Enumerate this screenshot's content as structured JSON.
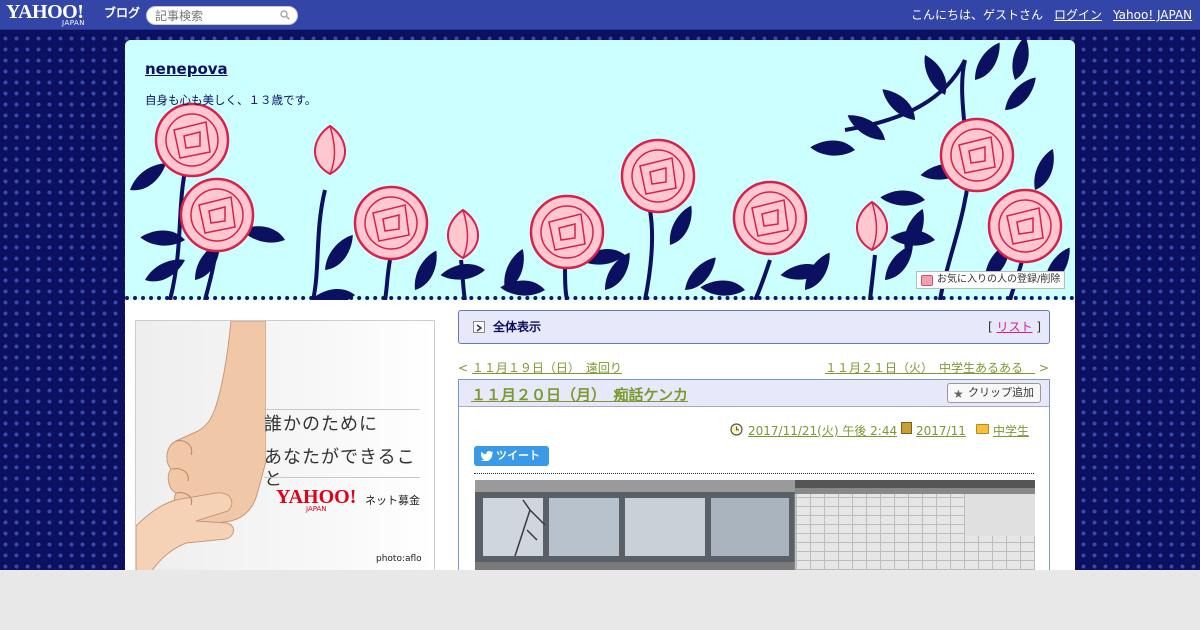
{
  "topbar": {
    "logo_word": "YAHOO!",
    "logo_sub": "JAPAN",
    "logo_blog": "ブログ",
    "search_placeholder": "記事検索",
    "greeting": "こんにちは、ゲストさん",
    "login": "ログイン",
    "yahoo_japan": "Yahoo! JAPAN"
  },
  "header": {
    "blog_title": "nenepova",
    "description": "自身も心も美しく、１３歳です。",
    "favorite_button": "お気に入りの人の登録/削除"
  },
  "ad": {
    "line1": "誰かのために",
    "line2": "あなたができること",
    "yahoo": "YAHOO!",
    "yahoo_sub": "JAPAN",
    "donation": "ネット募金",
    "photo_credit": "photo:aflo"
  },
  "nav": {
    "label": "全体表示",
    "list_open": "[",
    "list_link": "リスト",
    "list_close": "]"
  },
  "pager": {
    "prev_arrow": "<",
    "prev": "１１月１９日（日）　遠回り",
    "next": "１１月２１日（火）　中学生あるある　",
    "next_arrow": ">"
  },
  "entry": {
    "title": "１１月２０日（月）　痴話ケンカ",
    "clip_button": "クリップ追加",
    "datetime": "2017/11/21(火) 午後 2:44",
    "month": "2017/11",
    "category": "中学生",
    "tweet": "ツイート"
  },
  "colors": {
    "topbar": "#3346a8",
    "background": "#0c1060",
    "header_bg": "#ccffff",
    "link_green": "#7a9a30",
    "nav_bg": "#e8e8fb"
  }
}
